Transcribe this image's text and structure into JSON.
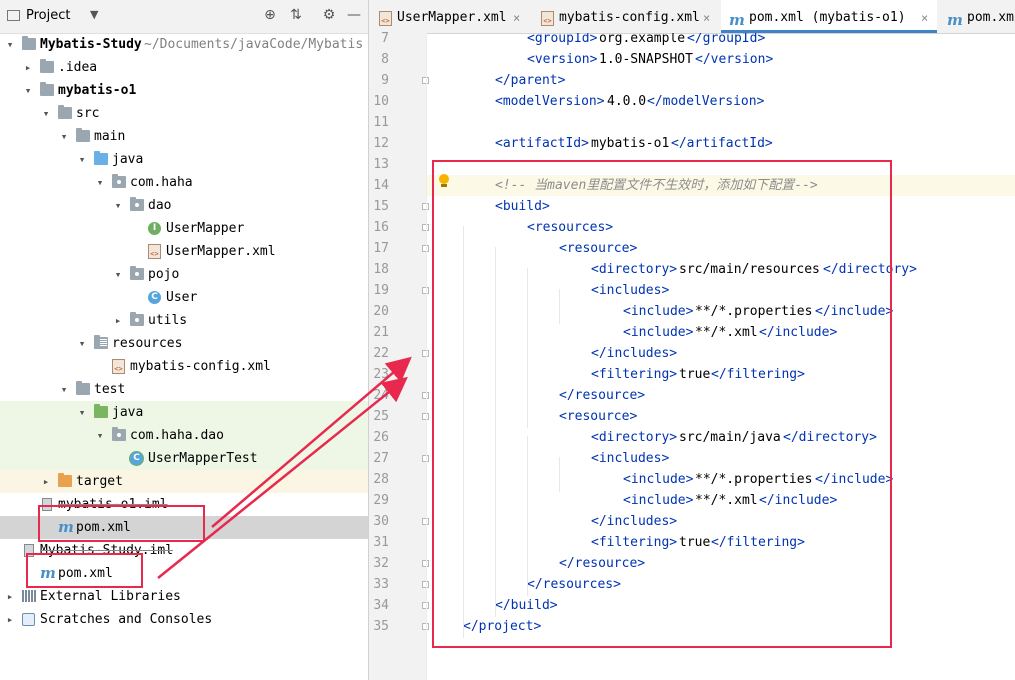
{
  "project_panel": {
    "title": "Project",
    "title_chevron": "chevron-down-icon",
    "toolbar_icons": [
      "locate-icon",
      "collapse-all-icon",
      "gear-icon",
      "minimize-icon"
    ]
  },
  "tree": [
    {
      "label": "Mybatis-Study",
      "suffix": " ~/Documents/javaCode/Mybatis",
      "icon": "folder-icon",
      "arrow": "▾",
      "bold": true
    },
    {
      "label": ".idea",
      "icon": "folder-icon",
      "arrow": "▸"
    },
    {
      "label": "mybatis-o1",
      "icon": "module-folder-icon",
      "arrow": "▾",
      "bold": true
    },
    {
      "label": "src",
      "icon": "folder-icon",
      "arrow": "▾"
    },
    {
      "label": "main",
      "icon": "folder-icon",
      "arrow": "▾"
    },
    {
      "label": "java",
      "icon": "source-folder-icon",
      "arrow": "▾"
    },
    {
      "label": "com.haha",
      "icon": "package-icon",
      "arrow": "▾"
    },
    {
      "label": "dao",
      "icon": "package-icon",
      "arrow": "▾"
    },
    {
      "label": "UserMapper",
      "icon": "interface-icon"
    },
    {
      "label": "UserMapper.xml",
      "icon": "xml-file-icon"
    },
    {
      "label": "pojo",
      "icon": "package-icon",
      "arrow": "▾"
    },
    {
      "label": "User",
      "icon": "class-icon"
    },
    {
      "label": "utils",
      "icon": "package-icon",
      "arrow": "▸"
    },
    {
      "label": "resources",
      "icon": "resources-folder-icon",
      "arrow": "▾"
    },
    {
      "label": "mybatis-config.xml",
      "icon": "xml-file-icon"
    },
    {
      "label": "test",
      "icon": "folder-icon",
      "arrow": "▾"
    },
    {
      "label": "java",
      "icon": "test-folder-icon",
      "arrow": "▾"
    },
    {
      "label": "com.haha.dao",
      "icon": "package-icon",
      "arrow": "▾"
    },
    {
      "label": "UserMapperTest",
      "icon": "test-class-icon"
    },
    {
      "label": "target",
      "icon": "excluded-folder-icon",
      "arrow": "▸"
    },
    {
      "label": "mybatis-o1.iml",
      "icon": "iml-file-icon"
    },
    {
      "label": "pom.xml",
      "icon": "maven-pom-icon",
      "selected": true
    },
    {
      "label": "Mybatis-Study.iml",
      "icon": "iml-file-icon"
    },
    {
      "label": "pom.xml",
      "icon": "maven-pom-icon"
    },
    {
      "label": "External Libraries",
      "icon": "library-icon",
      "arrow": "▸"
    },
    {
      "label": "Scratches and Consoles",
      "icon": "scratches-icon",
      "arrow": "▸"
    }
  ],
  "tabs": [
    {
      "label": "UserMapper.xml",
      "icon": "xml-file-icon",
      "close": "×"
    },
    {
      "label": "mybatis-config.xml",
      "icon": "xml-file-icon",
      "close": "×"
    },
    {
      "label": "pom.xml (mybatis-o1)",
      "icon": "maven-pom-icon",
      "close": "×",
      "active": true
    },
    {
      "label": "pom.xml",
      "icon": "maven-pom-icon"
    }
  ],
  "editor": {
    "highlight_line": 14,
    "lines": [
      {
        "n": "7",
        "indent": 2,
        "parts": [
          [
            "t",
            "<groupId>"
          ],
          [
            "x",
            "org.example"
          ],
          [
            "t",
            "</groupId>"
          ]
        ]
      },
      {
        "n": "8",
        "indent": 2,
        "parts": [
          [
            "t",
            "<version>"
          ],
          [
            "x",
            "1.0-SNAPSHOT"
          ],
          [
            "t",
            "</version>"
          ]
        ]
      },
      {
        "n": "9",
        "indent": 1,
        "parts": [
          [
            "t",
            "</parent>"
          ]
        ],
        "fold": true
      },
      {
        "n": "10",
        "indent": 1,
        "parts": [
          [
            "t",
            "<modelVersion>"
          ],
          [
            "x",
            "4.0.0"
          ],
          [
            "t",
            "</modelVersion>"
          ]
        ]
      },
      {
        "n": "11",
        "indent": 0,
        "parts": []
      },
      {
        "n": "12",
        "indent": 1,
        "parts": [
          [
            "t",
            "<artifactId>"
          ],
          [
            "x",
            "mybatis-o1"
          ],
          [
            "t",
            "</artifactId>"
          ]
        ]
      },
      {
        "n": "13",
        "indent": 0,
        "parts": []
      },
      {
        "n": "14",
        "indent": 1,
        "parts": [
          [
            "c",
            "<!-- 当maven里配置文件不生效时，添加如下配置-->"
          ]
        ]
      },
      {
        "n": "15",
        "indent": 1,
        "parts": [
          [
            "t",
            "<build>"
          ]
        ],
        "fold": true
      },
      {
        "n": "16",
        "indent": 2,
        "parts": [
          [
            "t",
            "<resources>"
          ]
        ],
        "fold": true
      },
      {
        "n": "17",
        "indent": 3,
        "parts": [
          [
            "t",
            "<resource>"
          ]
        ],
        "fold": true
      },
      {
        "n": "18",
        "indent": 4,
        "parts": [
          [
            "t",
            "<directory>"
          ],
          [
            "x",
            "src/main/resources"
          ],
          [
            "t",
            "</directory>"
          ]
        ]
      },
      {
        "n": "19",
        "indent": 4,
        "parts": [
          [
            "t",
            "<includes>"
          ]
        ],
        "fold": true
      },
      {
        "n": "20",
        "indent": 5,
        "parts": [
          [
            "t",
            "<include>"
          ],
          [
            "x",
            "**/*.properties"
          ],
          [
            "t",
            "</include>"
          ]
        ]
      },
      {
        "n": "21",
        "indent": 5,
        "parts": [
          [
            "t",
            "<include>"
          ],
          [
            "x",
            "**/*.xml"
          ],
          [
            "t",
            "</include>"
          ]
        ]
      },
      {
        "n": "22",
        "indent": 4,
        "parts": [
          [
            "t",
            "</includes>"
          ]
        ],
        "fold": true
      },
      {
        "n": "23",
        "indent": 4,
        "parts": [
          [
            "t",
            "<filtering>"
          ],
          [
            "x",
            "true"
          ],
          [
            "t",
            "</filtering>"
          ]
        ]
      },
      {
        "n": "24",
        "indent": 3,
        "parts": [
          [
            "t",
            "</resource>"
          ]
        ],
        "fold": true
      },
      {
        "n": "25",
        "indent": 3,
        "parts": [
          [
            "t",
            "<resource>"
          ]
        ],
        "fold": true
      },
      {
        "n": "26",
        "indent": 4,
        "parts": [
          [
            "t",
            "<directory>"
          ],
          [
            "x",
            "src/main/java"
          ],
          [
            "t",
            "</directory>"
          ]
        ]
      },
      {
        "n": "27",
        "indent": 4,
        "parts": [
          [
            "t",
            "<includes>"
          ]
        ],
        "fold": true
      },
      {
        "n": "28",
        "indent": 5,
        "parts": [
          [
            "t",
            "<include>"
          ],
          [
            "x",
            "**/*.properties"
          ],
          [
            "t",
            "</include>"
          ]
        ]
      },
      {
        "n": "29",
        "indent": 5,
        "parts": [
          [
            "t",
            "<include>"
          ],
          [
            "x",
            "**/*.xml"
          ],
          [
            "t",
            "</include>"
          ]
        ]
      },
      {
        "n": "30",
        "indent": 4,
        "parts": [
          [
            "t",
            "</includes>"
          ]
        ],
        "fold": true
      },
      {
        "n": "31",
        "indent": 4,
        "parts": [
          [
            "t",
            "<filtering>"
          ],
          [
            "x",
            "true"
          ],
          [
            "t",
            "</filtering>"
          ]
        ]
      },
      {
        "n": "32",
        "indent": 3,
        "parts": [
          [
            "t",
            "</resource>"
          ]
        ],
        "fold": true
      },
      {
        "n": "33",
        "indent": 2,
        "parts": [
          [
            "t",
            "</resources>"
          ]
        ],
        "fold": true
      },
      {
        "n": "34",
        "indent": 1,
        "parts": [
          [
            "t",
            "</build>"
          ]
        ],
        "fold": true
      },
      {
        "n": "35",
        "indent": 0,
        "parts": [
          [
            "t",
            "</project>"
          ]
        ],
        "fold": true
      }
    ]
  },
  "annotation_color": "#e8294d"
}
